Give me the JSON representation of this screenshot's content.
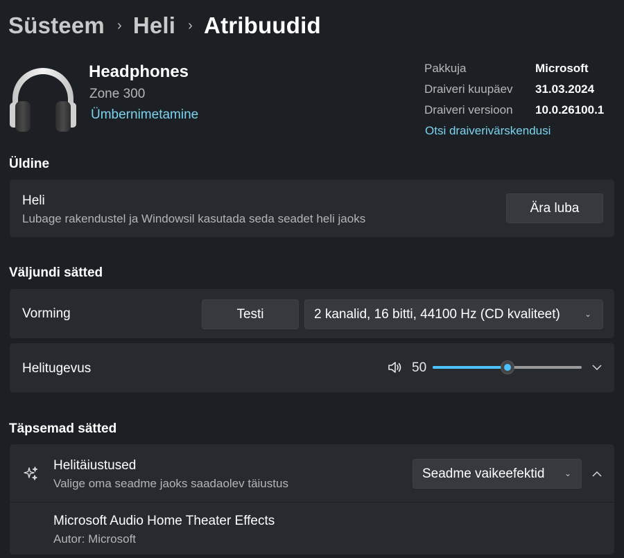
{
  "breadcrumb": {
    "item1": "Süsteem",
    "item2": "Heli",
    "current": "Atribuudid",
    "separator": "›"
  },
  "device": {
    "name": "Headphones",
    "model": "Zone 300",
    "rename_link": "Ümbernimetamine"
  },
  "driver_info": {
    "provider_label": "Pakkuja",
    "provider_value": "Microsoft",
    "date_label": "Draiveri kuupäev",
    "date_value": "31.03.2024",
    "version_label": "Draiveri versioon",
    "version_value": "10.0.26100.1",
    "update_link": "Otsi draiverivärskendusi"
  },
  "general": {
    "heading": "Üldine",
    "audio_title": "Heli",
    "audio_description": "Lubage rakendustel ja Windowsil kasutada seda seadet heli jaoks",
    "disable_button": "Ära luba"
  },
  "output": {
    "heading": "Väljundi sätted",
    "format_label": "Vorming",
    "test_button": "Testi",
    "format_value": "2 kanalid, 16 bitti, 44100 Hz (CD kvaliteet)",
    "volume_label": "Helitugevus",
    "volume_value": "50",
    "volume_level": 0.5
  },
  "advanced": {
    "heading": "Täpsemad sätted",
    "enhancements_title": "Helitäiustused",
    "enhancements_description": "Valige oma seadme jaoks saadaolev täiustus",
    "enhancements_value": "Seadme vaikeefektid",
    "effect_name": "Microsoft Audio Home Theater Effects",
    "effect_author": "Autor: Microsoft"
  },
  "colors": {
    "accent": "#4cc2ff",
    "link": "#7cd3f0",
    "background": "#1c2024",
    "card": "#272b30"
  },
  "icons": {
    "device": "headphones-icon",
    "volume": "speaker-icon",
    "enhancements": "sparkle-icon"
  }
}
